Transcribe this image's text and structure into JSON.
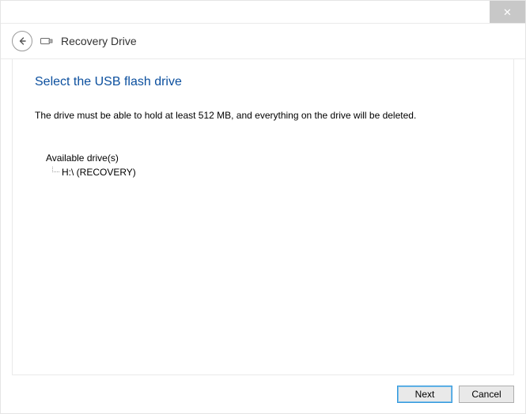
{
  "titlebar": {
    "close_glyph": "✕"
  },
  "header": {
    "app_title": "Recovery Drive"
  },
  "main": {
    "heading": "Select the USB flash drive",
    "instruction": "The drive must be able to hold at least 512 MB, and everything on the drive will be deleted.",
    "list_label": "Available drive(s)",
    "drives": [
      {
        "label": "H:\\ (RECOVERY)"
      }
    ]
  },
  "footer": {
    "next_label": "Next",
    "cancel_label": "Cancel"
  }
}
